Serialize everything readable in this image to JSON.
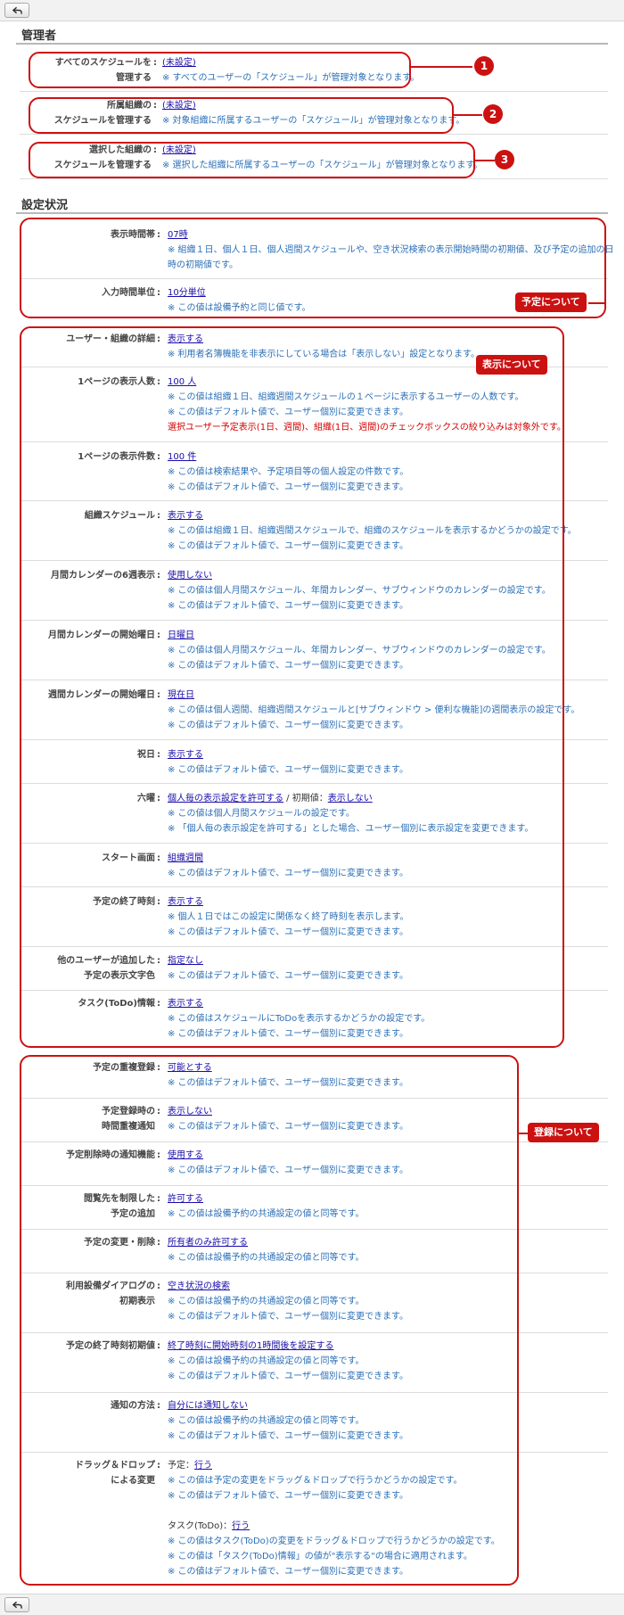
{
  "toolbar": {
    "back_label": "戻る"
  },
  "admin": {
    "title": "管理者",
    "rows": [
      {
        "label1": "すべてのスケジュールを",
        "label2": "管理する",
        "value": "(未設定)",
        "note": "※ すべてのユーザーの「スケジュール」が管理対象となります。",
        "badge": "1"
      },
      {
        "label1": "所属組織の",
        "label2": "スケジュールを管理する",
        "value": "(未設定)",
        "note": "※ 対象組織に所属するユーザーの「スケジュール」が管理対象となります。",
        "badge": "2"
      },
      {
        "label1": "選択した組織の",
        "label2": "スケジュールを管理する",
        "value": "(未設定)",
        "note": "※ 選択した組織に所属するユーザーの「スケジュール」が管理対象となります。",
        "badge": "3"
      }
    ]
  },
  "settings": {
    "title": "設定状況",
    "tags": {
      "schedule": "予定について",
      "display": "表示について",
      "register": "登録について"
    },
    "r01": {
      "label": "表示時間帯",
      "value": "07時",
      "n1": "※ 組織１日、個人１日、個人週間スケジュールや、空き状況検索の表示開始時間の初期値、及び予定の追加の日",
      "n2": "時の初期値です。"
    },
    "r02": {
      "label": "入力時間単位",
      "value": "10分単位",
      "n1": "※ この値は設備予約と同じ値です。"
    },
    "r03": {
      "label": "ユーザー・組織の詳細",
      "value": "表示する",
      "n1": "※ 利用者名簿機能を非表示にしている場合は「表示しない」設定となります。"
    },
    "r04": {
      "label": "1ページの表示人数",
      "value": "100 人",
      "n1": "※ この値は組織１日、組織週間スケジュールの１ページに表示するユーザーの人数です。",
      "n2": "※ この値はデフォルト値で、ユーザー個別に変更できます。",
      "w1": "選択ユーザー予定表示(1日、週間)、組織(1日、週間)のチェックボックスの絞り込みは対象外です。"
    },
    "r05": {
      "label": "1ページの表示件数",
      "value": "100 件",
      "n1": "※ この値は検索結果や、予定項目等の個人設定の件数です。",
      "n2": "※ この値はデフォルト値で、ユーザー個別に変更できます。"
    },
    "r06": {
      "label": "組織スケジュール",
      "value": "表示する",
      "n1": "※ この値は組織１日、組織週間スケジュールで、組織のスケジュールを表示するかどうかの設定です。",
      "n2": "※ この値はデフォルト値で、ユーザー個別に変更できます。"
    },
    "r07": {
      "label": "月間カレンダーの6週表示",
      "value": "使用しない",
      "n1": "※ この値は個人月間スケジュール、年間カレンダー、サブウィンドウのカレンダーの設定です。",
      "n2": "※ この値はデフォルト値で、ユーザー個別に変更できます。"
    },
    "r08": {
      "label": "月間カレンダーの開始曜日",
      "value": "日曜日",
      "n1": "※ この値は個人月間スケジュール、年間カレンダー、サブウィンドウのカレンダーの設定です。",
      "n2": "※ この値はデフォルト値で、ユーザー個別に変更できます。"
    },
    "r09": {
      "label": "週間カレンダーの開始曜日",
      "value": "現在日",
      "n1": "※ この値は個人週間、組織週間スケジュールと[サブウィンドウ > 便利な機能]の週間表示の設定です。",
      "n2": "※ この値はデフォルト値で、ユーザー個別に変更できます。"
    },
    "r10": {
      "label": "祝日",
      "value": "表示する",
      "n1": "※ この値はデフォルト値で、ユーザー個別に変更できます。"
    },
    "r11": {
      "label": "六曜",
      "value": "個人毎の表示設定を許可する",
      "sep": " / 初期値：",
      "value2": "表示しない",
      "n1": "※ この値は個人月間スケジュールの設定です。",
      "n2": "※ 「個人毎の表示設定を許可する」とした場合、ユーザー個別に表示設定を変更できます。"
    },
    "r12": {
      "label": "スタート画面",
      "value": "組織週間",
      "n1": "※ この値はデフォルト値で、ユーザー個別に変更できます。"
    },
    "r13": {
      "label": "予定の終了時刻",
      "value": "表示する",
      "n1": "※ 個人１日ではこの設定に関係なく終了時刻を表示します。",
      "n2": "※ この値はデフォルト値で、ユーザー個別に変更できます。"
    },
    "r14": {
      "label1": "他のユーザーが追加した",
      "label2": "予定の表示文字色",
      "value": "指定なし",
      "n1": "※ この値はデフォルト値で、ユーザー個別に変更できます。"
    },
    "r15": {
      "label": "タスク(ToDo)情報",
      "value": "表示する",
      "n1": "※ この値はスケジュールにToDoを表示するかどうかの設定です。",
      "n2": "※ この値はデフォルト値で、ユーザー個別に変更できます。"
    },
    "r16": {
      "label": "予定の重複登録",
      "value": "可能とする",
      "n1": "※ この値はデフォルト値で、ユーザー個別に変更できます。"
    },
    "r17": {
      "label1": "予定登録時の",
      "label2": "時間重複通知",
      "value": "表示しない",
      "n1": "※ この値はデフォルト値で、ユーザー個別に変更できます。"
    },
    "r18": {
      "label": "予定削除時の通知機能",
      "value": "使用する",
      "n1": "※ この値はデフォルト値で、ユーザー個別に変更できます。"
    },
    "r19": {
      "label1": "閲覧先を制限した",
      "label2": "予定の追加",
      "value": "許可する",
      "n1": "※ この値は設備予約の共通設定の値と同等です。"
    },
    "r20": {
      "label": "予定の変更・削除",
      "value": "所有者のみ許可する",
      "n1": "※ この値は設備予約の共通設定の値と同等です。"
    },
    "r21": {
      "label1": "利用設備ダイアログの",
      "label2": "初期表示",
      "value": "空き状況の検索",
      "n1": "※ この値は設備予約の共通設定の値と同等です。",
      "n2": "※ この値はデフォルト値で、ユーザー個別に変更できます。"
    },
    "r22": {
      "label": "予定の終了時刻初期値",
      "value": "終了時刻に開始時刻の1時間後を設定する",
      "n1": "※ この値は設備予約の共通設定の値と同等です。",
      "n2": "※ この値はデフォルト値で、ユーザー個別に変更できます。"
    },
    "r23": {
      "label": "通知の方法",
      "value": "自分には通知しない",
      "n1": "※ この値は設備予約の共通設定の値と同等です。",
      "n2": "※ この値はデフォルト値で、ユーザー個別に変更できます。"
    },
    "r24": {
      "label1": "ドラッグ＆ドロップ",
      "label2": "による変更",
      "prefix1": "予定：",
      "value": "行う",
      "n1": "※ この値は予定の変更をドラッグ＆ドロップで行うかどうかの設定です。",
      "n2": "※ この値はデフォルト値で、ユーザー個別に変更できます。",
      "prefix2": "タスク(ToDo)：",
      "value2": "行う",
      "n3": "※ この値はタスク(ToDo)の変更をドラッグ＆ドロップで行うかどうかの設定です。",
      "n4": "※ この値は「タスク(ToDo)情報」の値が\"表示する\"の場合に適用されます。",
      "n5": "※ この値はデフォルト値で、ユーザー個別に変更できます。"
    }
  },
  "colors": {
    "accent": "#cc1111",
    "link": "#1a0dab",
    "note": "#2b6fb6",
    "warn": "#d40000"
  }
}
